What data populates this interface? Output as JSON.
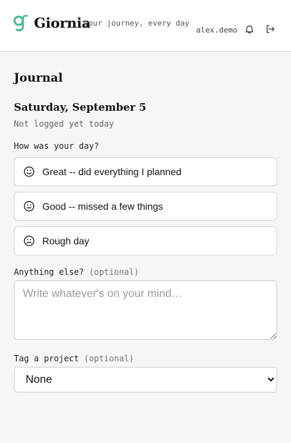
{
  "header": {
    "brand": "Giornia",
    "tagline": "your journey, every day",
    "username": "alex.demo",
    "accent_color": "#4bb89a",
    "icons": [
      "logo-icon",
      "bell-icon",
      "logout-icon"
    ]
  },
  "journal": {
    "title": "Journal",
    "date": "Saturday, September 5",
    "status": "Not logged yet today",
    "question": "How was your day?",
    "options": [
      {
        "label": "Great -- did everything I planned",
        "icon": "smile-icon"
      },
      {
        "label": "Good -- missed a few things",
        "icon": "neutral-face-icon"
      },
      {
        "label": "Rough day",
        "icon": "frown-icon"
      }
    ],
    "notes": {
      "label": "Anything else?",
      "optional": "(optional)",
      "placeholder": "Write whatever's on your mind…",
      "value": ""
    },
    "project": {
      "label": "Tag a project",
      "optional": "(optional)",
      "selected": "None"
    }
  }
}
